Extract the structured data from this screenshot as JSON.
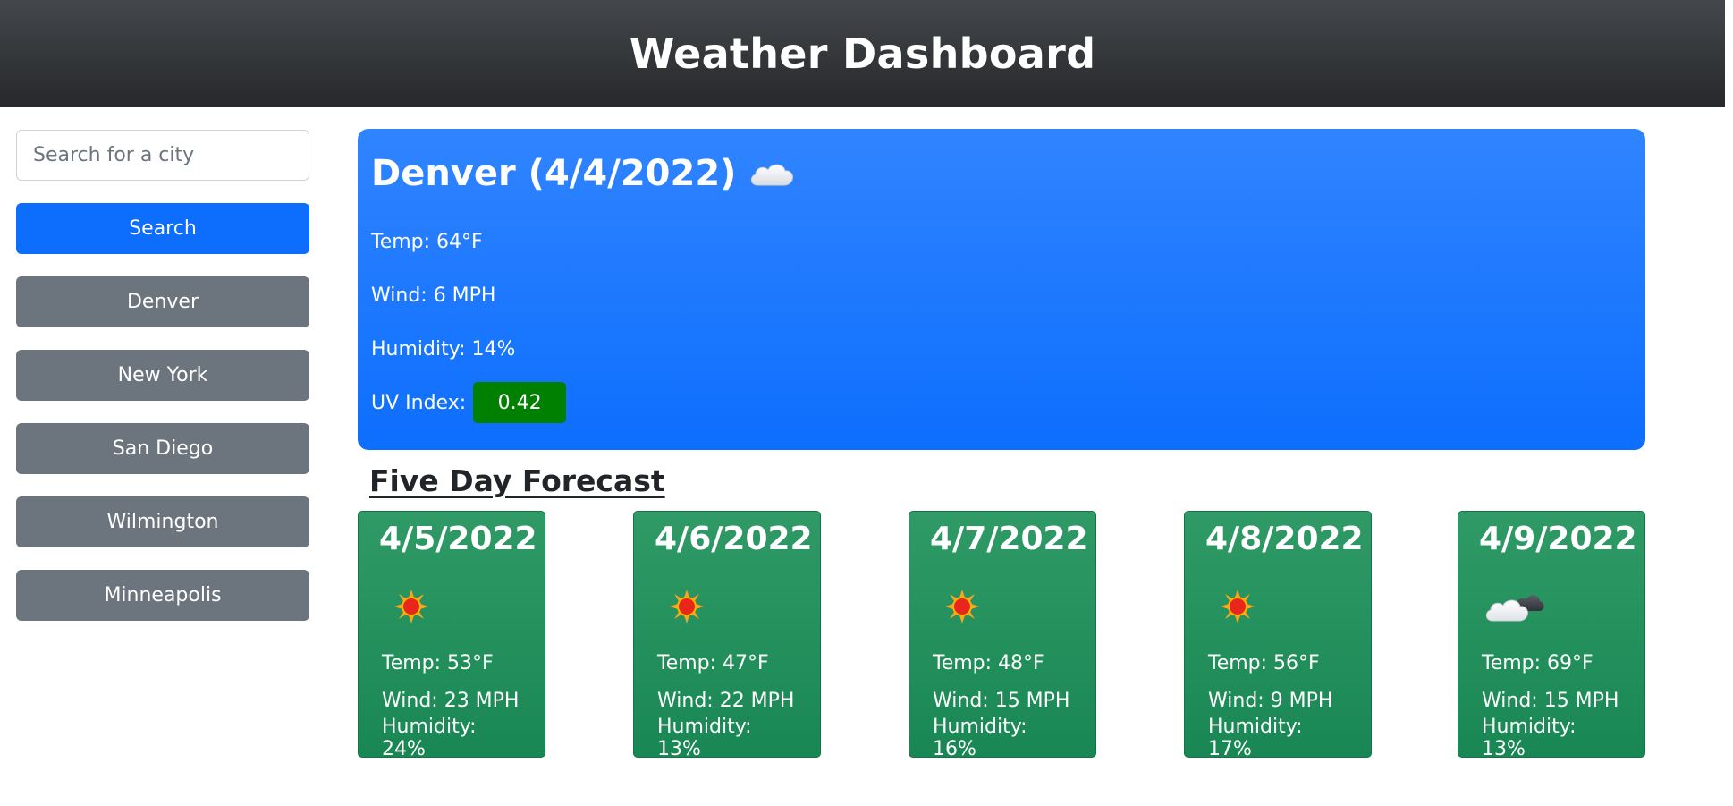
{
  "header": {
    "title": "Weather Dashboard"
  },
  "sidebar": {
    "search_placeholder": "Search for a city",
    "search_value": "",
    "search_label": "Search",
    "history": [
      "Denver",
      "New York",
      "San Diego",
      "Wilmington",
      "Minneapolis"
    ]
  },
  "current": {
    "heading": "Denver (4/4/2022)",
    "icon": "cloud-icon",
    "temp": "Temp: 64°F",
    "wind": "Wind: 6 MPH",
    "humidity": "Humidity: 14%",
    "uv_label": "UV Index:",
    "uv_value": "0.42",
    "uv_color": "#008000"
  },
  "forecast": {
    "heading": "Five Day Forecast",
    "days": [
      {
        "date": "4/5/2022",
        "icon": "sun-icon",
        "temp": "Temp: 53°F",
        "wind": "Wind: 23 MPH",
        "humidity": "Humidity: 24%"
      },
      {
        "date": "4/6/2022",
        "icon": "sun-icon",
        "temp": "Temp: 47°F",
        "wind": "Wind: 22 MPH",
        "humidity": "Humidity: 13%"
      },
      {
        "date": "4/7/2022",
        "icon": "sun-icon",
        "temp": "Temp: 48°F",
        "wind": "Wind: 15 MPH",
        "humidity": "Humidity: 16%"
      },
      {
        "date": "4/8/2022",
        "icon": "sun-icon",
        "temp": "Temp: 56°F",
        "wind": "Wind: 9 MPH",
        "humidity": "Humidity: 17%"
      },
      {
        "date": "4/9/2022",
        "icon": "broken-clouds-icon",
        "temp": "Temp: 69°F",
        "wind": "Wind: 15 MPH",
        "humidity": "Humidity: 13%"
      }
    ]
  },
  "colors": {
    "primary": "#0d6efd",
    "secondary": "#6c757d",
    "success": "#198754",
    "header": "#343a40"
  }
}
